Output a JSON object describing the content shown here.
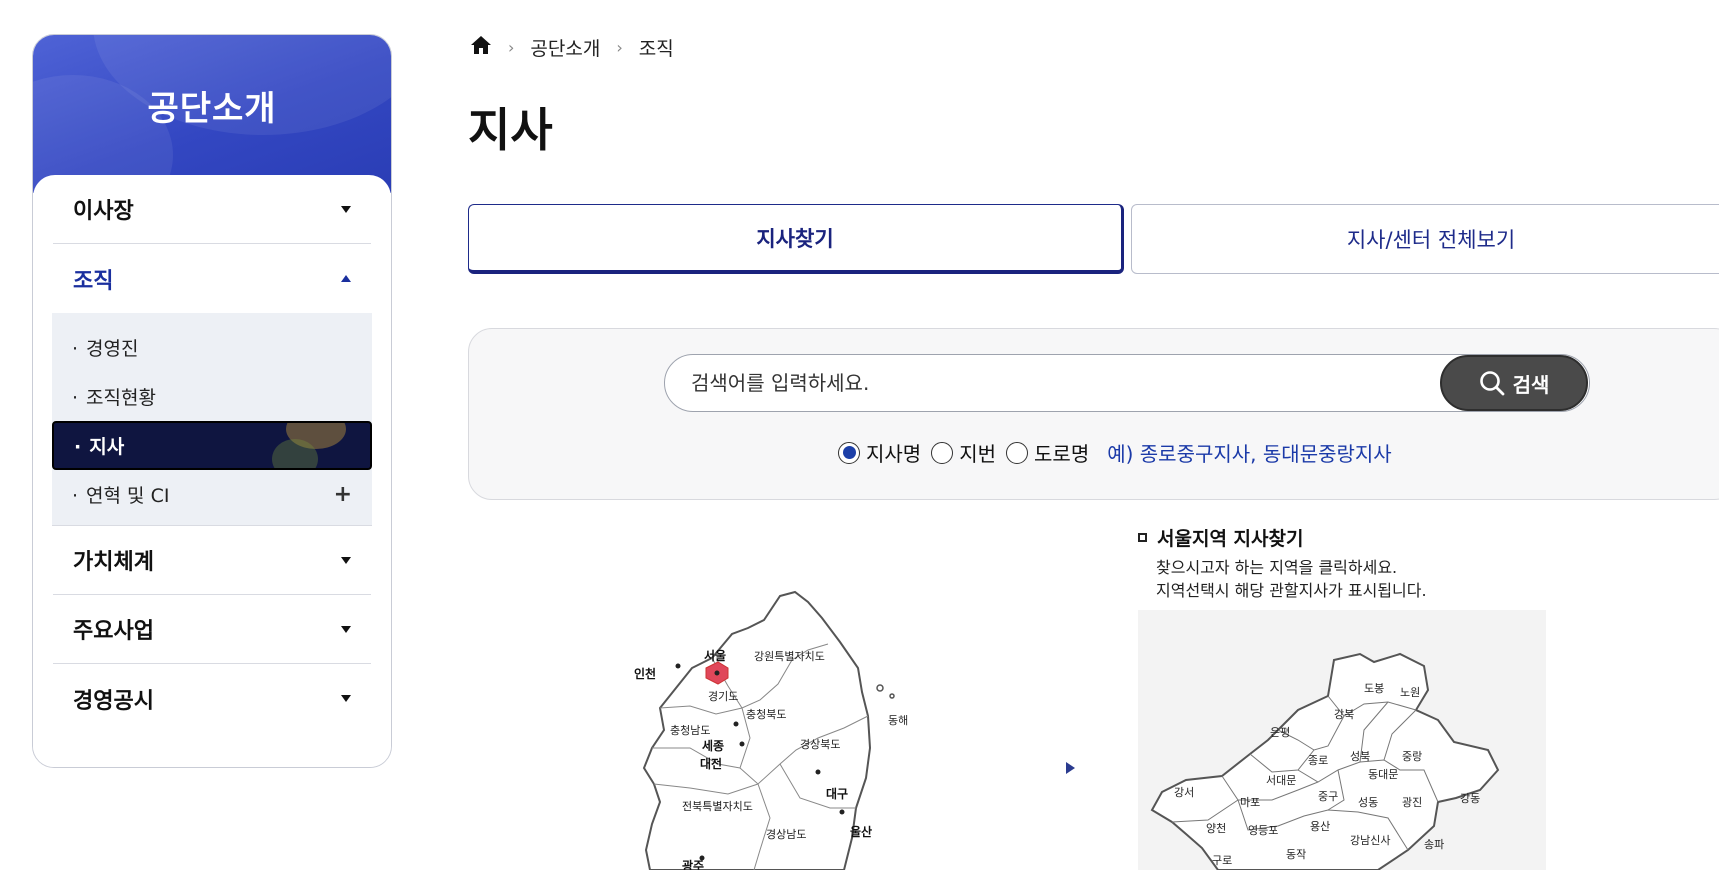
{
  "sidebar": {
    "title": "공단소개",
    "menu": [
      {
        "label": "이사장"
      },
      {
        "label": "조직"
      },
      {
        "label": "가치체계"
      },
      {
        "label": "주요사업"
      },
      {
        "label": "경영공시"
      }
    ],
    "submenu": [
      {
        "label": "경영진"
      },
      {
        "label": "조직현황"
      },
      {
        "label": "지사"
      },
      {
        "label": "연혁 및 CI"
      }
    ]
  },
  "breadcrumb": [
    "공단소개",
    "조직"
  ],
  "page": {
    "title": "지사"
  },
  "tabs": [
    {
      "label": "지사찾기",
      "active": true
    },
    {
      "label": "지사/센터 전체보기",
      "active": false
    }
  ],
  "search": {
    "placeholder": "검색어를 입력하세요.",
    "button_label": "검색",
    "options": [
      {
        "label": "지사명",
        "checked": true
      },
      {
        "label": "지번",
        "checked": false
      },
      {
        "label": "도로명",
        "checked": false
      }
    ],
    "example": "예) 종로중구지사, 동대문중랑지사"
  },
  "korea_map": {
    "regions": [
      "서울",
      "인천",
      "강원특별자치도",
      "경기도",
      "충청북도",
      "충청남도",
      "세종",
      "대전",
      "경상북도",
      "대구",
      "전북특별자치도",
      "경상남도",
      "울산",
      "광주",
      "동해"
    ]
  },
  "seoul_section": {
    "title": "서울지역 지사찾기",
    "desc_line1": "찾으시고자 하는 지역을 클릭하세요.",
    "desc_line2": "지역선택시 해당 관할지사가 표시됩니다.",
    "districts": [
      "도봉",
      "노원",
      "강북",
      "은평",
      "성북",
      "중랑",
      "종로",
      "서대문",
      "동대문",
      "강서",
      "마포",
      "중구",
      "성동",
      "광진",
      "강동",
      "양천",
      "영등포",
      "용산",
      "동작",
      "강남신사",
      "송파",
      "구로"
    ]
  },
  "colors": {
    "brand": "#3347c2",
    "tab_active": "#1a237e",
    "current_submenu": "#0f1540",
    "seoul_marker": "#e0475a"
  }
}
